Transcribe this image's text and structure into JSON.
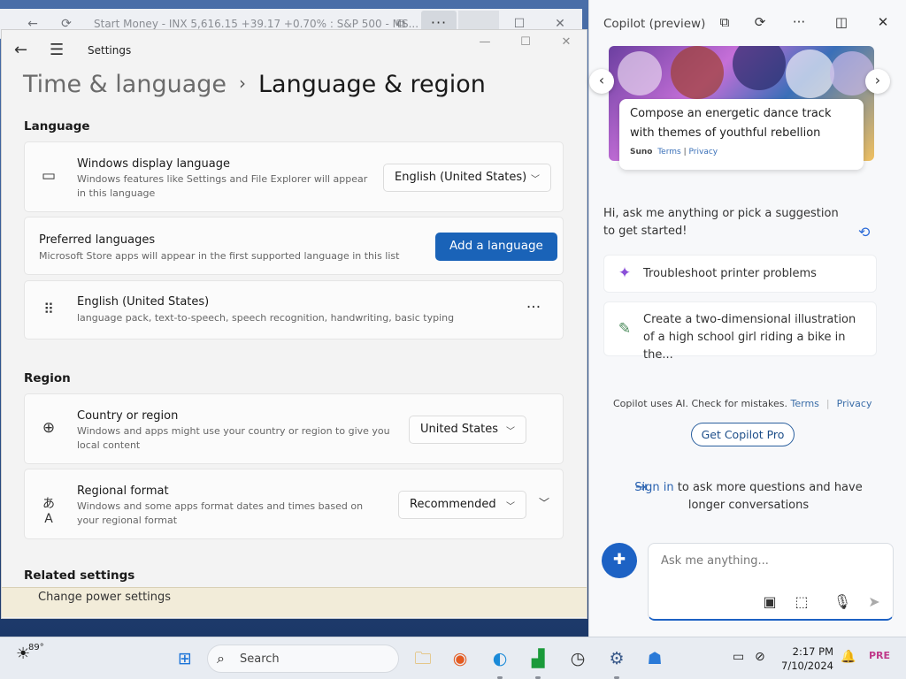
{
  "background_window": {
    "title": "Start Money - INX 5,616.15 +39.17 +0.70% : S&P 500 - MS..."
  },
  "settings": {
    "app_title": "Settings",
    "breadcrumb": {
      "parent": "Time & language",
      "current": "Language & region"
    },
    "language_section": "Language",
    "display_language": {
      "title": "Windows display language",
      "description": "Windows features like Settings and File Explorer will appear in this language",
      "value": "English (United States)"
    },
    "preferred": {
      "title": "Preferred languages",
      "description": "Microsoft Store apps will appear in the first supported language in this list",
      "add_button": "Add a language"
    },
    "language_item": {
      "title": "English (United States)",
      "description": "language pack, text-to-speech, speech recognition, handwriting, basic typing"
    },
    "region_section": "Region",
    "country": {
      "title": "Country or region",
      "description": "Windows and apps might use your country or region to give you local content",
      "value": "United States"
    },
    "regional_format": {
      "title": "Regional format",
      "description": "Windows and some apps format dates and times based on your regional format",
      "value": "Recommended"
    },
    "related_section": "Related settings",
    "overlay_text": "Change power settings"
  },
  "copilot": {
    "title": "Copilot (preview)",
    "hero": {
      "text": "Compose an energetic dance track with themes of youthful rebellion",
      "source": "Suno",
      "terms": "Terms",
      "separator": "|",
      "privacy": "Privacy"
    },
    "greeting": "Hi, ask me anything or pick a suggestion to get started!",
    "suggestions": [
      {
        "text": "Troubleshoot printer problems",
        "icon": "sparkle-icon"
      },
      {
        "text": "Create a two-dimensional illustration of a high school girl riding a bike in the...",
        "icon": "palette-icon"
      }
    ],
    "disclaimer": {
      "text": "Copilot uses AI. Check for mistakes.",
      "terms": "Terms",
      "privacy": "Privacy"
    },
    "pro_button": "Get Copilot Pro",
    "signin": {
      "link": "Sign in",
      "rest": "to ask more questions and have longer conversations"
    },
    "input_placeholder": "Ask me anything..."
  },
  "taskbar": {
    "temperature": "89°",
    "search_label": "Search",
    "time": "2:17 PM",
    "date": "7/10/2024",
    "badge": "PRE"
  },
  "colors": {
    "accent": "#1a63b8",
    "copilot_accent": "#1d62c4"
  }
}
